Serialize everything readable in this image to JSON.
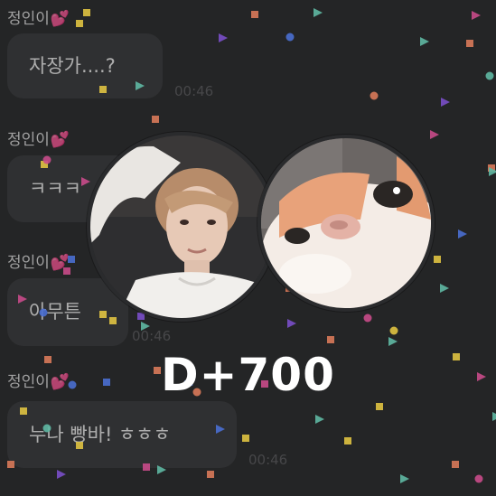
{
  "messages": [
    {
      "sender": "정인이",
      "heart": "💕",
      "text": "자장가....?",
      "time": "00:46"
    },
    {
      "sender": "정인이",
      "heart": "💕",
      "text": "ㅋㅋㅋ",
      "time": ""
    },
    {
      "sender": "정인이",
      "heart": "💕",
      "text": "아무튼",
      "time": "00:46"
    },
    {
      "sender": "정인이",
      "heart": "💕",
      "text": "누나 빵바! ㅎㅎㅎ",
      "time": "00:46"
    }
  ],
  "overlay": {
    "dday": "D+700",
    "left_avatar": "person-photo",
    "right_avatar": "cat-photo"
  },
  "colors": {
    "background": "#2a2b2d",
    "bubble": "#3a3b3d",
    "heart": "#7a1f45",
    "confetti": [
      "#5fb8a3",
      "#c94b8a",
      "#e0c341",
      "#d97a5a",
      "#4a6fd1",
      "#7a4fc9"
    ]
  }
}
